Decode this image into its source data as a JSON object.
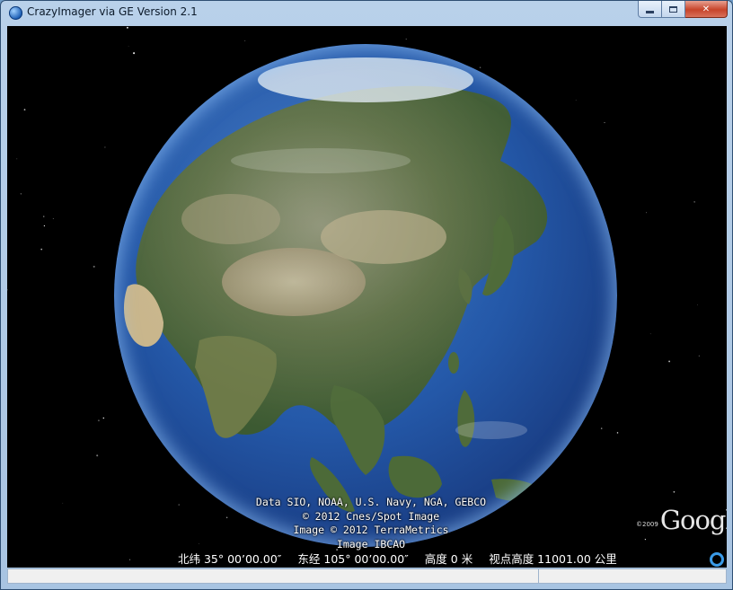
{
  "window": {
    "title": "CrazyImager via GE Version 2.1",
    "buttons": {
      "minimize": "minimize",
      "maximize": "maximize",
      "close": "✕"
    }
  },
  "colors": {
    "accent": "#3a9be8",
    "space": "#000000",
    "ocean": "#2458a8"
  },
  "view": {
    "attribution": [
      "Data SIO, NOAA, U.S. Navy, NGA, GEBCO",
      "© 2012 Cnes/Spot Image",
      "Image © 2012 TerraMetrics",
      "Image IBCAO"
    ],
    "logo": {
      "copyright": "©2009",
      "name": "Google"
    },
    "status": {
      "latitude": "北纬  35° 00’00.00″",
      "longitude": "东经  105° 00’00.00″",
      "elevation": "高度     0 米",
      "eye_altitude": "视点高度  11001.00 公里"
    }
  },
  "statusbar": {
    "panel1": "",
    "panel2": ""
  }
}
